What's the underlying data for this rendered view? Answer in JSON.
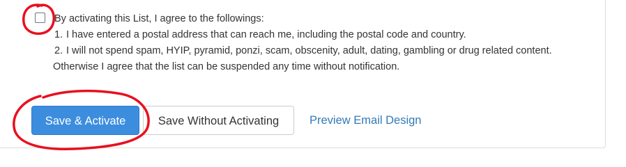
{
  "agreement": {
    "checked": false,
    "intro": "By activating this List, I agree to the followings:",
    "items": [
      {
        "num": "1.",
        "text": "I have entered a postal address that can reach me, including the postal code and country."
      },
      {
        "num": "2.",
        "text": "I will not spend spam, HYIP, pyramid, ponzi, scam, obscenity, adult, dating, gambling or drug related content."
      }
    ],
    "outro": "Otherwise I agree that the list can be suspended any time without notification."
  },
  "actions": {
    "save_activate_label": "Save & Activate",
    "save_without_label": "Save Without Activating",
    "preview_label": "Preview Email Design"
  },
  "colors": {
    "primary": "#3c8dde",
    "link": "#337ab7",
    "annotation": "#e8101f"
  }
}
